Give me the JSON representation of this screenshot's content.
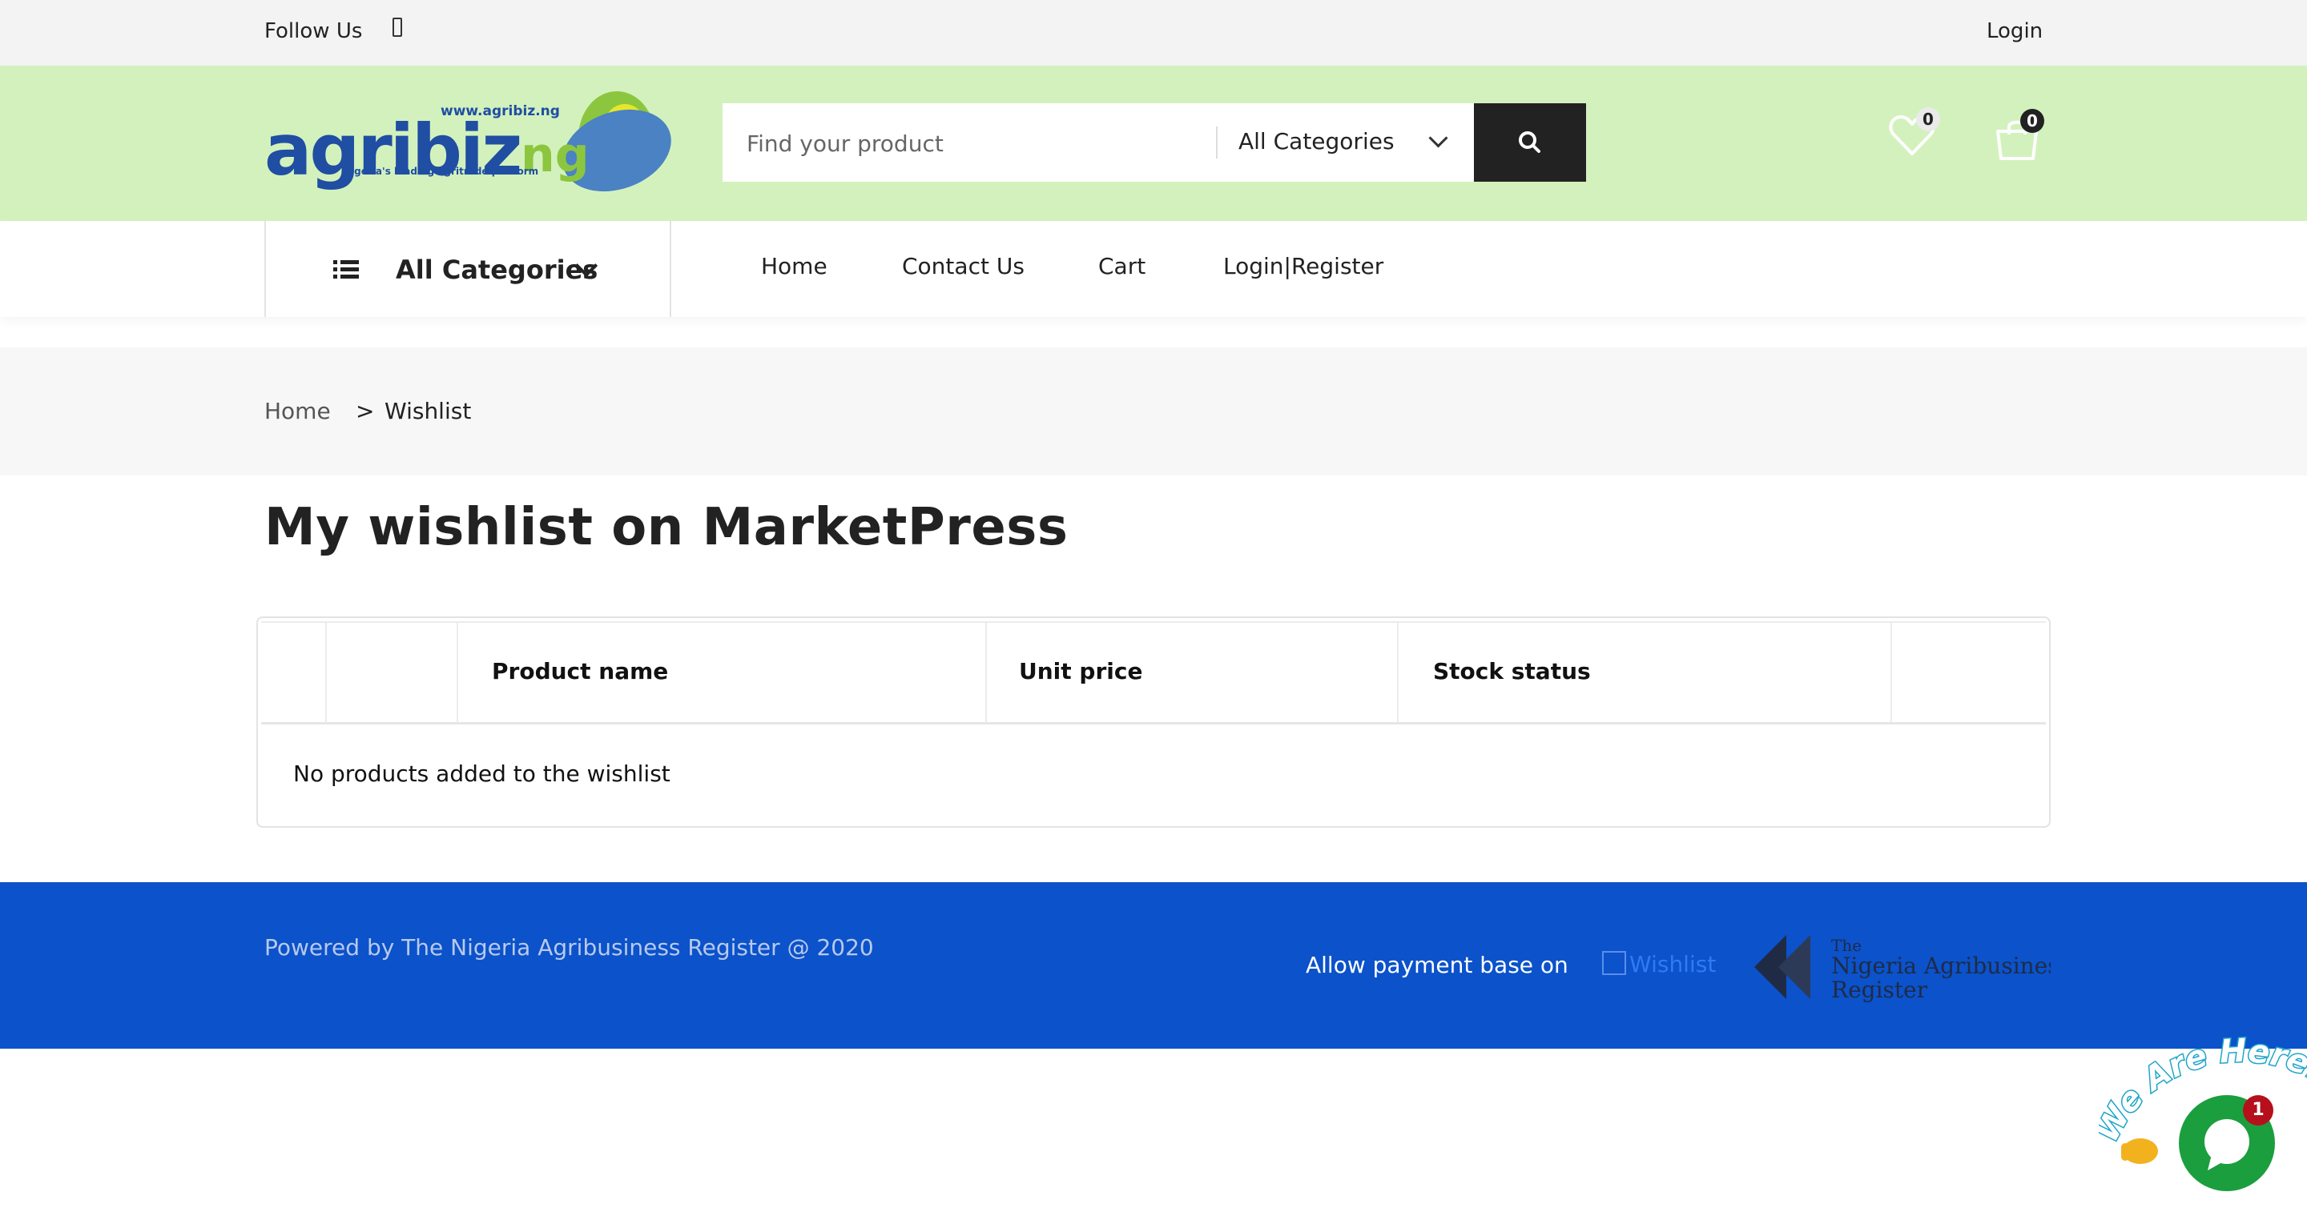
{
  "topbar": {
    "follow_label": "Follow Us",
    "login_label": "Login"
  },
  "logo": {
    "wordmark_main": "agribiz",
    "wordmark_suffix": "ng",
    "url": "www.agribiz.ng",
    "tagline": "Nigeria's leading agritrade platform"
  },
  "search": {
    "placeholder": "Find your product",
    "category_selected": "All Categories"
  },
  "header": {
    "wishlist_count": "0",
    "cart_count": "0"
  },
  "nav": {
    "all_categories_label": "All Categories",
    "items": [
      {
        "label": "Home"
      },
      {
        "label": "Contact Us"
      },
      {
        "label": "Cart"
      },
      {
        "label": "Login|Register"
      }
    ]
  },
  "breadcrumb": {
    "home": "Home",
    "separator": ">",
    "current": "Wishlist"
  },
  "page": {
    "title": "My wishlist on MarketPress"
  },
  "table": {
    "headers": {
      "product_name": "Product name",
      "unit_price": "Unit price",
      "stock_status": "Stock status"
    },
    "empty_message": "No products added to the wishlist"
  },
  "footer": {
    "powered_by": "Powered by The Nigeria Agribusiness Register @ 2020",
    "allow_payment": "Allow payment base on",
    "payment_image_alt": "Wishlist",
    "register_logo_line1": "The",
    "register_logo_line2": "Nigeria Agribusiness",
    "register_logo_line3": "Register"
  },
  "chat": {
    "banner": "We Are Here!",
    "badge_count": "1"
  },
  "colors": {
    "header_bg": "#d3f1bd",
    "footer_bg": "#0b52cb",
    "search_button": "#222222",
    "logo_blue": "#1f4ea3",
    "logo_green": "#8cc63f",
    "chat_green": "#1b9e3e",
    "badge_red": "#b5101b"
  }
}
